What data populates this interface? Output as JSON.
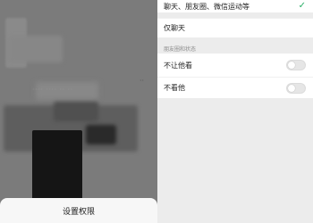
{
  "background": {
    "blur_text": "···· ···· ·· ··",
    "dots": "··"
  },
  "sheet": {
    "button_label": "设置权限"
  },
  "permissions": {
    "option_all": "聊天、朋友圈、微信运动等",
    "option_chat_only": "仅聊天",
    "section_title": "朋友圈和状态",
    "hide_mine_label": "不让他看",
    "hide_mine_on": false,
    "hide_theirs_label": "不看他",
    "hide_theirs_on": false,
    "selected_option": "option_all"
  },
  "colors": {
    "check": "#2aae67",
    "backdrop": "#7b7b7b",
    "panel_bg": "#ececec"
  }
}
